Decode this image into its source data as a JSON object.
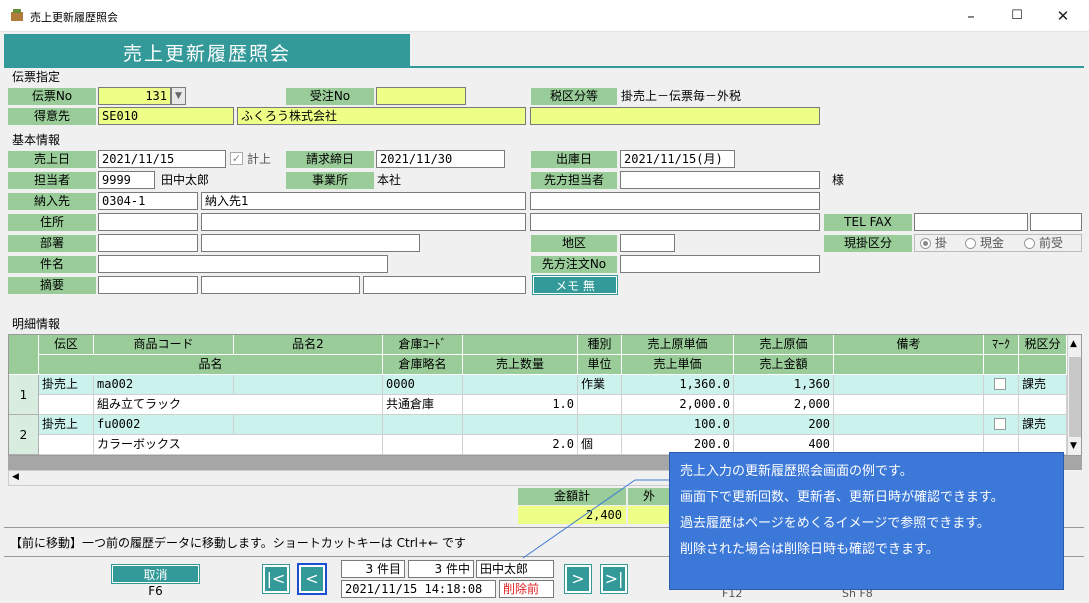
{
  "window": {
    "title": "売上更新履歴照会",
    "minimize": "–",
    "maximize": "☐",
    "close": "✕"
  },
  "banner": {
    "title": "売上更新履歴照会"
  },
  "slip": {
    "section": "伝票指定",
    "denpyo_no_label": "伝票No",
    "denpyo_no": "131",
    "juchu_no_label": "受注No",
    "juchu_no": "",
    "zei_label": "税区分等",
    "zei_value": "掛売上－伝票毎－外税",
    "tokuisaki_label": "得意先",
    "tokuisaki_code": "SE010",
    "tokuisaki_name": "ふくろう株式会社",
    "tokuisaki_extra": ""
  },
  "basic": {
    "section": "基本情報",
    "uriage_bi_label": "売上日",
    "uriage_bi": "2021/11/15",
    "keijo_label": "計上",
    "seikyu_label": "請求締日",
    "seikyu": "2021/11/30",
    "shukko_label": "出庫日",
    "shukko": "2021/11/15(月)",
    "tanto_label": "担当者",
    "tanto_code": "9999",
    "tanto_name": "田中太郎",
    "jigyo_label": "事業所",
    "jigyo": "本社",
    "saki_tanto_label": "先方担当者",
    "saki_tanto": "",
    "sama": "様",
    "nonyu_label": "納入先",
    "nonyu_code": "0304-1",
    "nonyu_name": "納入先1",
    "jusho_label": "住所",
    "telfax_label": "TEL FAX",
    "busho_label": "部署",
    "chiku_label": "地区",
    "genkake_label": "現掛区分",
    "opt_kake": "掛",
    "opt_genkin": "現金",
    "opt_maeuke": "前受",
    "kenmei_label": "件名",
    "saki_chumon_label": "先方注文No",
    "tekiyo_label": "摘要",
    "memo_button": "メモ 無"
  },
  "detail": {
    "section": "明細情報",
    "headers_top": [
      "伝区",
      "商品コード",
      "品名2",
      "倉庫ｺｰﾄﾞ",
      "",
      "種別",
      "売上原単価",
      "売上原価",
      "備考",
      "ﾏｰｸ",
      "税区分"
    ],
    "headers_bottom": [
      "品名",
      "倉庫略名",
      "売上数量",
      "単位",
      "売上単価",
      "売上金額"
    ],
    "rows": [
      {
        "no": "1",
        "denku": "掛売上",
        "code": "ma002",
        "soko_code": "0000",
        "shubetsu": "作業",
        "gen_tanka": "1,360.0",
        "genka": "1,360",
        "zei": "課売",
        "name": "組み立てラック",
        "soko_name": "共通倉庫",
        "qty": "1.0",
        "unit": "",
        "tanka": "2,000.0",
        "kingaku": "2,000"
      },
      {
        "no": "2",
        "denku": "掛売上",
        "code": "fu0002",
        "soko_code": "",
        "shubetsu": "",
        "gen_tanka": "100.0",
        "genka": "200",
        "zei": "課売",
        "name": "カラーボックス",
        "soko_name": "",
        "qty": "2.0",
        "unit": "個",
        "tanka": "200.0",
        "kingaku": "400"
      }
    ]
  },
  "totals": {
    "kingaku_label": "金額計",
    "kingaku": "2,400",
    "next_label": "外"
  },
  "status": {
    "message": "【前に移動】一つ前の履歴データに移動します。ショートカットキーは Ctrl+← です"
  },
  "footer": {
    "cancel_button": "取消",
    "cancel_key": "F6",
    "first": "|<",
    "prev": "<",
    "next": ">",
    "last": ">|",
    "count": "3 件目",
    "total": "3 件中",
    "user": "田中太郎",
    "timestamp": "2021/11/15 14:18:08",
    "state": "削除前",
    "hidden_key1": "F12",
    "hidden_key2": "Sh F8"
  },
  "callout": {
    "lines": [
      "売上入力の更新履歴照会画面の例です。",
      "画面下で更新回数、更新者、更新日時が確認できます。",
      "過去履歴はページをめくるイメージで参照できます。",
      "削除された場合は削除日時も確認できます。"
    ]
  },
  "colors": {
    "accent": "#339999",
    "label_green": "#99cc99",
    "yellow": "#eeff88",
    "callout": "#3c78d8"
  }
}
